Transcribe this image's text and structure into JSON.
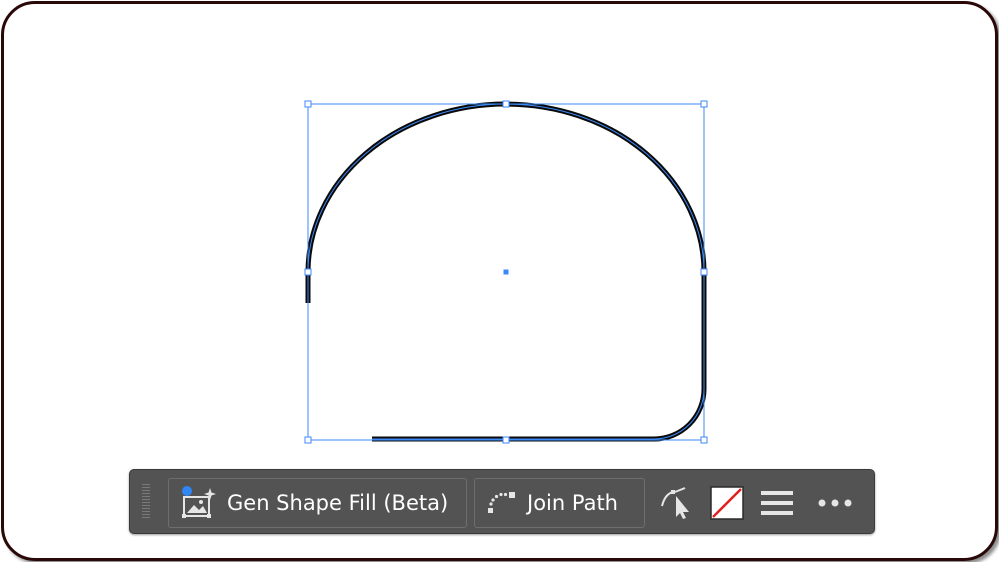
{
  "toolbar": {
    "gen_shape_fill_label": "Gen Shape Fill (Beta)",
    "join_path_label": "Join Path"
  },
  "icons": {
    "gen_shape_fill": "gen-shape-fill-icon",
    "join_path": "join-path-icon",
    "pen_tool": "pen-tool-icon",
    "stroke_swatch": "stroke-swatch-icon",
    "align": "hamburger-menu-icon",
    "more": "more-options-icon"
  },
  "colors": {
    "canvas_background": "#ffffff",
    "frame_border": "#2a0808",
    "toolbar_background": "#535353",
    "selection": "#3d8af7",
    "path_stroke": "#0a0a0a",
    "no_fill_slash": "#e02020",
    "badge_dot": "#2f86f5"
  }
}
